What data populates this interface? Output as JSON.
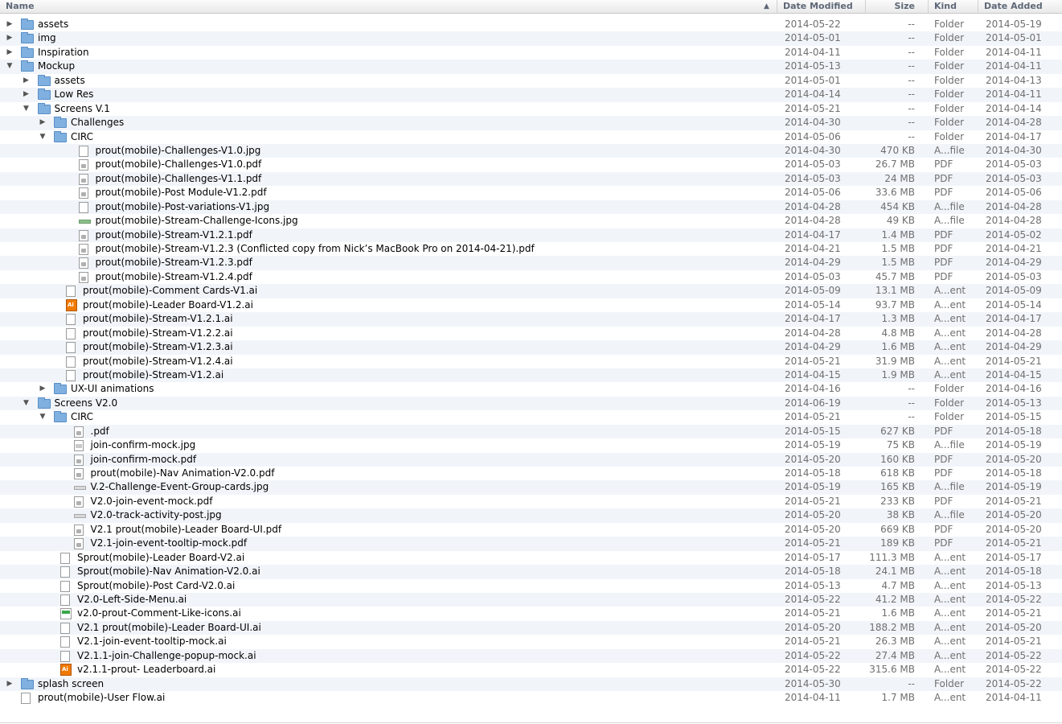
{
  "columns": {
    "name": "Name",
    "date_modified": "Date Modified",
    "size": "Size",
    "kind": "Kind",
    "date_added": "Date Added"
  },
  "rows": [
    {
      "name": "assets",
      "depth": 0,
      "toggle": "closed",
      "icon": "folder",
      "modified": "2014-05-22",
      "size": "--",
      "kind": "Folder",
      "added": "2014-05-19"
    },
    {
      "name": "img",
      "depth": 0,
      "toggle": "closed",
      "icon": "folder",
      "modified": "2014-05-01",
      "size": "--",
      "kind": "Folder",
      "added": "2014-05-01"
    },
    {
      "name": "Inspiration",
      "depth": 0,
      "toggle": "closed",
      "icon": "folder",
      "modified": "2014-04-11",
      "size": "--",
      "kind": "Folder",
      "added": "2014-04-11"
    },
    {
      "name": "Mockup",
      "depth": 0,
      "toggle": "open",
      "icon": "folder",
      "modified": "2014-05-13",
      "size": "--",
      "kind": "Folder",
      "added": "2014-04-11"
    },
    {
      "name": "assets",
      "depth": 1,
      "toggle": "closed",
      "icon": "folder",
      "modified": "2014-05-01",
      "size": "--",
      "kind": "Folder",
      "added": "2014-04-13"
    },
    {
      "name": "Low Res",
      "depth": 1,
      "toggle": "closed",
      "icon": "folder",
      "modified": "2014-04-14",
      "size": "--",
      "kind": "Folder",
      "added": "2014-04-11"
    },
    {
      "name": "Screens V.1",
      "depth": 1,
      "toggle": "open",
      "icon": "folder",
      "modified": "2014-05-21",
      "size": "--",
      "kind": "Folder",
      "added": "2014-04-14"
    },
    {
      "name": "Challenges",
      "depth": 2,
      "toggle": "closed",
      "icon": "folder",
      "modified": "2014-04-30",
      "size": "--",
      "kind": "Folder",
      "added": "2014-04-28"
    },
    {
      "name": "CIRC",
      "depth": 2,
      "toggle": "open",
      "icon": "folder",
      "modified": "2014-05-06",
      "size": "--",
      "kind": "Folder",
      "added": "2014-04-17"
    },
    {
      "name": "prout(mobile)-Challenges-V1.0.jpg",
      "depth": 3,
      "toggle": "none",
      "icon": "doc",
      "modified": "2014-04-30",
      "size": "470 KB",
      "kind": "A...file",
      "added": "2014-04-30"
    },
    {
      "name": "prout(mobile)-Challenges-V1.0.pdf",
      "depth": 3,
      "toggle": "none",
      "icon": "pdf",
      "modified": "2014-05-03",
      "size": "26.7 MB",
      "kind": "PDF",
      "added": "2014-05-03"
    },
    {
      "name": "prout(mobile)-Challenges-V1.1.pdf",
      "depth": 3,
      "toggle": "none",
      "icon": "pdf",
      "modified": "2014-05-03",
      "size": "24 MB",
      "kind": "PDF",
      "added": "2014-05-03"
    },
    {
      "name": "prout(mobile)-Post Module-V1.2.pdf",
      "depth": 3,
      "toggle": "none",
      "icon": "pdf",
      "modified": "2014-05-06",
      "size": "33.6 MB",
      "kind": "PDF",
      "added": "2014-05-06"
    },
    {
      "name": "prout(mobile)-Post-variations-V1.jpg",
      "depth": 3,
      "toggle": "none",
      "icon": "doc",
      "modified": "2014-04-28",
      "size": "454 KB",
      "kind": "A...file",
      "added": "2014-04-28"
    },
    {
      "name": "prout(mobile)-Stream-Challenge-Icons.jpg",
      "depth": 3,
      "toggle": "none",
      "icon": "jpg-green",
      "modified": "2014-04-28",
      "size": "49 KB",
      "kind": "A...file",
      "added": "2014-04-28"
    },
    {
      "name": "prout(mobile)-Stream-V1.2.1.pdf",
      "depth": 3,
      "toggle": "none",
      "icon": "pdf",
      "modified": "2014-04-17",
      "size": "1.4 MB",
      "kind": "PDF",
      "added": "2014-05-02"
    },
    {
      "name": "prout(mobile)-Stream-V1.2.3 (Conflicted copy from Nick’s MacBook Pro on 2014-04-21).pdf",
      "depth": 3,
      "toggle": "none",
      "icon": "pdf",
      "modified": "2014-04-21",
      "size": "1.5 MB",
      "kind": "PDF",
      "added": "2014-04-21"
    },
    {
      "name": "prout(mobile)-Stream-V1.2.3.pdf",
      "depth": 3,
      "toggle": "none",
      "icon": "pdf",
      "modified": "2014-04-29",
      "size": "1.5 MB",
      "kind": "PDF",
      "added": "2014-04-29"
    },
    {
      "name": "prout(mobile)-Stream-V1.2.4.pdf",
      "depth": 3,
      "toggle": "none",
      "icon": "pdf",
      "modified": "2014-05-03",
      "size": "45.7 MB",
      "kind": "PDF",
      "added": "2014-05-03"
    },
    {
      "name": "prout(mobile)-Comment Cards-V1.ai",
      "depth": 2,
      "toggle": "none",
      "icon": "ai",
      "modified": "2014-05-09",
      "size": "13.1 MB",
      "kind": "A...ent",
      "added": "2014-05-09"
    },
    {
      "name": "prout(mobile)-Leader Board-V1.2.ai",
      "depth": 2,
      "toggle": "none",
      "icon": "ai-orange",
      "modified": "2014-05-14",
      "size": "93.7 MB",
      "kind": "A...ent",
      "added": "2014-05-14"
    },
    {
      "name": "prout(mobile)-Stream-V1.2.1.ai",
      "depth": 2,
      "toggle": "none",
      "icon": "ai",
      "modified": "2014-04-17",
      "size": "1.3 MB",
      "kind": "A...ent",
      "added": "2014-04-17"
    },
    {
      "name": "prout(mobile)-Stream-V1.2.2.ai",
      "depth": 2,
      "toggle": "none",
      "icon": "ai",
      "modified": "2014-04-28",
      "size": "4.8 MB",
      "kind": "A...ent",
      "added": "2014-04-28"
    },
    {
      "name": "prout(mobile)-Stream-V1.2.3.ai",
      "depth": 2,
      "toggle": "none",
      "icon": "ai",
      "modified": "2014-04-29",
      "size": "1.6 MB",
      "kind": "A...ent",
      "added": "2014-04-29"
    },
    {
      "name": "prout(mobile)-Stream-V1.2.4.ai",
      "depth": 2,
      "toggle": "none",
      "icon": "ai",
      "modified": "2014-05-21",
      "size": "31.9 MB",
      "kind": "A...ent",
      "added": "2014-05-21"
    },
    {
      "name": "prout(mobile)-Stream-V1.2.ai",
      "depth": 2,
      "toggle": "none",
      "icon": "ai",
      "modified": "2014-04-15",
      "size": "1.9 MB",
      "kind": "A...ent",
      "added": "2014-04-15"
    },
    {
      "name": "UX-UI animations",
      "depth": 2,
      "toggle": "closed",
      "icon": "folder",
      "modified": "2014-04-16",
      "size": "--",
      "kind": "Folder",
      "added": "2014-04-16"
    },
    {
      "name": "Screens V2.0",
      "depth": 1,
      "toggle": "open",
      "icon": "folder",
      "modified": "2014-06-19",
      "size": "--",
      "kind": "Folder",
      "added": "2014-05-13"
    },
    {
      "name": "CIRC",
      "depth": 2,
      "toggle": "open",
      "icon": "folder",
      "modified": "2014-05-21",
      "size": "--",
      "kind": "Folder",
      "added": "2014-05-15"
    },
    {
      "name": ".pdf",
      "depth": 3,
      "toggle": "none",
      "icon": "pdf",
      "modified": "2014-05-15",
      "size": "627 KB",
      "kind": "PDF",
      "added": "2014-05-18"
    },
    {
      "name": "join-confirm-mock.jpg",
      "depth": 3,
      "toggle": "none",
      "icon": "jpg",
      "modified": "2014-05-19",
      "size": "75 KB",
      "kind": "A...file",
      "added": "2014-05-19"
    },
    {
      "name": "join-confirm-mock.pdf",
      "depth": 3,
      "toggle": "none",
      "icon": "pdf",
      "modified": "2014-05-20",
      "size": "160 KB",
      "kind": "PDF",
      "added": "2014-05-20"
    },
    {
      "name": "prout(mobile)-Nav Animation-V2.0.pdf",
      "depth": 3,
      "toggle": "none",
      "icon": "pdf",
      "modified": "2014-05-18",
      "size": "618 KB",
      "kind": "PDF",
      "added": "2014-05-18"
    },
    {
      "name": "V.2-Challenge-Event-Group-cards.jpg",
      "depth": 3,
      "toggle": "none",
      "icon": "jpg-wide",
      "modified": "2014-05-19",
      "size": "165 KB",
      "kind": "A...file",
      "added": "2014-05-19"
    },
    {
      "name": "V2.0-join-event-mock.pdf",
      "depth": 3,
      "toggle": "none",
      "icon": "pdf",
      "modified": "2014-05-21",
      "size": "233 KB",
      "kind": "PDF",
      "added": "2014-05-21"
    },
    {
      "name": "V2.0-track-activity-post.jpg",
      "depth": 3,
      "toggle": "none",
      "icon": "jpg-wide",
      "modified": "2014-05-20",
      "size": "38 KB",
      "kind": "A...file",
      "added": "2014-05-20"
    },
    {
      "name": "V2.1 prout(mobile)-Leader Board-UI.pdf",
      "depth": 3,
      "toggle": "none",
      "icon": "pdf",
      "modified": "2014-05-20",
      "size": "669 KB",
      "kind": "PDF",
      "added": "2014-05-20"
    },
    {
      "name": "V2.1-join-event-tooltip-mock.pdf",
      "depth": 3,
      "toggle": "none",
      "icon": "pdf",
      "modified": "2014-05-21",
      "size": "189 KB",
      "kind": "PDF",
      "added": "2014-05-21"
    },
    {
      "name": "Sprout(mobile)-Leader Board-V2.ai",
      "depth": 2,
      "toggle": "none",
      "icon": "ai",
      "modified": "2014-05-17",
      "size": "111.3 MB",
      "kind": "A...ent",
      "added": "2014-05-17"
    },
    {
      "name": "Sprout(mobile)-Nav Animation-V2.0.ai",
      "depth": 2,
      "toggle": "none",
      "icon": "ai",
      "modified": "2014-05-18",
      "size": "24.1 MB",
      "kind": "A...ent",
      "added": "2014-05-18"
    },
    {
      "name": "Sprout(mobile)-Post Card-V2.0.ai",
      "depth": 2,
      "toggle": "none",
      "icon": "ai",
      "modified": "2014-05-13",
      "size": "4.7 MB",
      "kind": "A...ent",
      "added": "2014-05-13"
    },
    {
      "name": "V2.0-Left-Side-Menu.ai",
      "depth": 2,
      "toggle": "none",
      "icon": "ai",
      "modified": "2014-05-22",
      "size": "41.2 MB",
      "kind": "A...ent",
      "added": "2014-05-22"
    },
    {
      "name": "v2.0-prout-Comment-Like-icons.ai",
      "depth": 2,
      "toggle": "none",
      "icon": "ai-green",
      "modified": "2014-05-21",
      "size": "1.6 MB",
      "kind": "A...ent",
      "added": "2014-05-21"
    },
    {
      "name": "V2.1 prout(mobile)-Leader Board-UI.ai",
      "depth": 2,
      "toggle": "none",
      "icon": "ai",
      "modified": "2014-05-20",
      "size": "188.2 MB",
      "kind": "A...ent",
      "added": "2014-05-20"
    },
    {
      "name": "V2.1-join-event-tooltip-mock.ai",
      "depth": 2,
      "toggle": "none",
      "icon": "ai",
      "modified": "2014-05-21",
      "size": "26.3 MB",
      "kind": "A...ent",
      "added": "2014-05-21"
    },
    {
      "name": "V2.1.1-join-Challenge-popup-mock.ai",
      "depth": 2,
      "toggle": "none",
      "icon": "ai",
      "modified": "2014-05-22",
      "size": "27.4 MB",
      "kind": "A...ent",
      "added": "2014-05-22"
    },
    {
      "name": "v2.1.1-prout- Leaderboard.ai",
      "depth": 2,
      "toggle": "none",
      "icon": "ai-orange",
      "modified": "2014-05-22",
      "size": "315.6 MB",
      "kind": "A...ent",
      "added": "2014-05-22"
    },
    {
      "name": "splash screen",
      "depth": 0,
      "toggle": "closed",
      "icon": "folder",
      "modified": "2014-05-30",
      "size": "--",
      "kind": "Folder",
      "added": "2014-05-22"
    },
    {
      "name": "prout(mobile)-User Flow.ai",
      "depth": 0,
      "toggle": "none",
      "icon": "ai",
      "modified": "2014-04-11",
      "size": "1.7 MB",
      "kind": "A...ent",
      "added": "2014-04-11"
    }
  ]
}
